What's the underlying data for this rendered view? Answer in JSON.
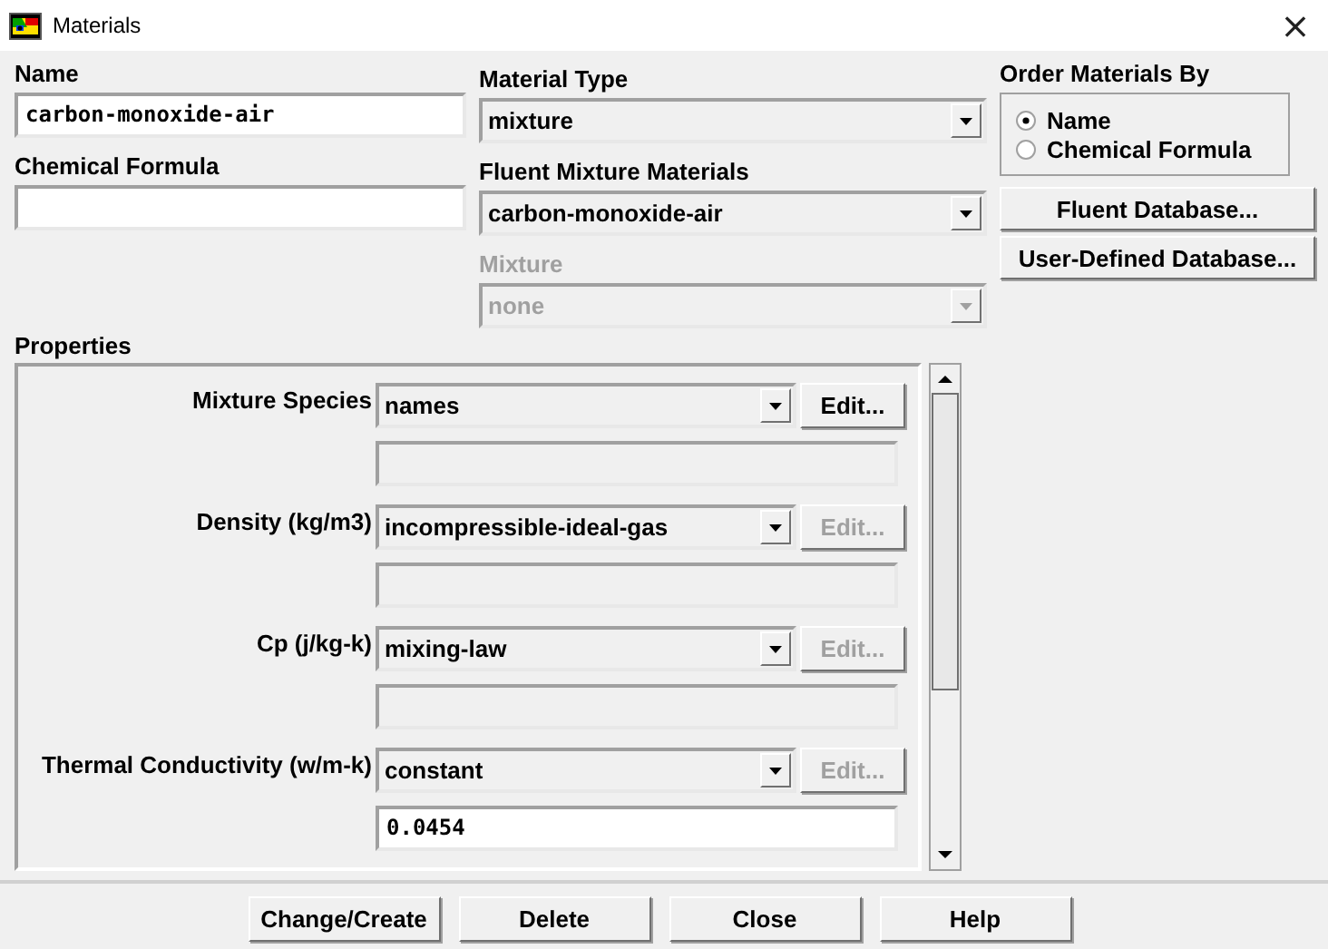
{
  "window": {
    "title": "Materials",
    "close": "×"
  },
  "name": {
    "label": "Name",
    "value": "carbon-monoxide-air"
  },
  "chemical_formula": {
    "label": "Chemical Formula"
  },
  "material_type": {
    "label": "Material Type",
    "value": "mixture",
    "disabled": false
  },
  "fluent_mixture_materials": {
    "label": "Fluent Mixture Materials",
    "value": "carbon-monoxide-air",
    "disabled": false
  },
  "mixture": {
    "label": "Mixture",
    "value": "none",
    "disabled": true
  },
  "order_materials_by": {
    "label": "Order Materials By",
    "options": [
      {
        "label": "Name",
        "selected": true
      },
      {
        "label": "Chemical Formula",
        "selected": false
      }
    ]
  },
  "database_buttons": [
    "Fluent Database...",
    "User-Defined Database..."
  ],
  "properties": {
    "label": "Properties",
    "rows": [
      {
        "label": "Mixture Species",
        "method": "names",
        "edit": {
          "label": "Edit...",
          "disabled": false
        },
        "field_disabled": true
      },
      {
        "label": "Density (kg/m3)",
        "method": "incompressible-ideal-gas",
        "edit": {
          "label": "Edit...",
          "disabled": true
        },
        "field_disabled": true
      },
      {
        "label": "Cp (j/kg-k)",
        "method": "mixing-law",
        "edit": {
          "label": "Edit...",
          "disabled": true
        },
        "field_disabled": true
      },
      {
        "label": "Thermal Conductivity (w/m-k)",
        "method": "constant",
        "edit": {
          "label": "Edit...",
          "disabled": true
        },
        "field_disabled": false,
        "value": "0.0454"
      }
    ]
  },
  "buttons": [
    "Change/Create",
    "Delete",
    "Close",
    "Help"
  ]
}
